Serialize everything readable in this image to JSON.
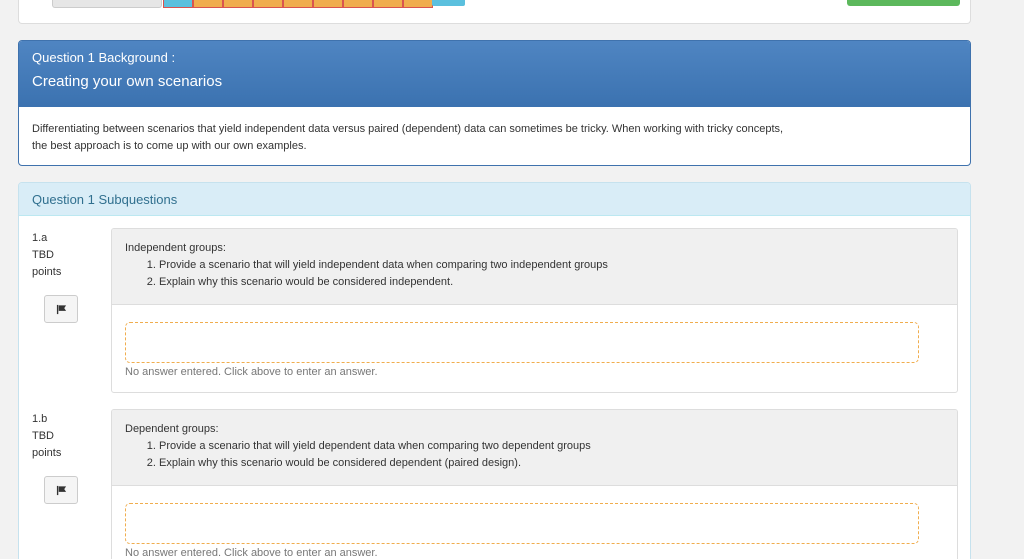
{
  "top_nav": {
    "question_boxes": [
      "",
      "",
      "",
      "",
      "",
      "",
      "",
      "",
      ""
    ]
  },
  "background": {
    "heading": "Question 1 Background :",
    "title": "Creating your own scenarios",
    "text": "Differentiating between scenarios that yield independent data versus paired (dependent) data can sometimes be tricky.   When working with tricky concepts, the best approach is to come up with our own examples."
  },
  "subquestions": {
    "heading": "Question 1 Subquestions",
    "items": [
      {
        "id": "1.a",
        "points_value": "TBD",
        "points_label": "points",
        "prompt_title": "Independent groups:",
        "steps": [
          "Provide a scenario that will yield independent data when comparing two independent groups",
          "Explain why this scenario would be considered independent."
        ],
        "answer_status": "No answer entered. Click above to enter an answer."
      },
      {
        "id": "1.b",
        "points_value": "TBD",
        "points_label": "points",
        "prompt_title": "Dependent groups:",
        "steps": [
          "Provide a scenario that will yield dependent data when comparing two dependent groups",
          "Explain why this scenario would be considered dependent (paired design)."
        ],
        "answer_status": "No answer entered. Click above to enter an answer."
      }
    ]
  },
  "colors": {
    "primary_header": "#3b72b0",
    "info_header": "#d9edf7",
    "answer_border": "#f0ad4e",
    "flag_box": "#d9534f"
  },
  "icons": {
    "flag": "flag-icon"
  }
}
